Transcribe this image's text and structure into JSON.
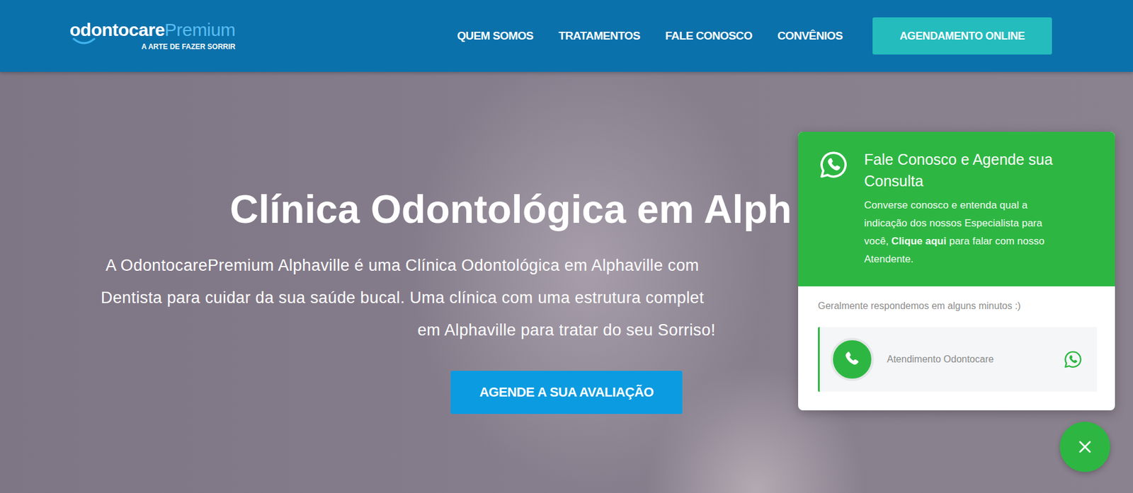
{
  "header": {
    "logo": {
      "brand": "odontocare",
      "suffix": "Premium",
      "tagline": "A ARTE DE FAZER SORRIR"
    },
    "nav": [
      {
        "label": "QUEM SOMOS"
      },
      {
        "label": "TRATAMENTOS"
      },
      {
        "label": "FALE CONOSCO"
      },
      {
        "label": "CONVÊNIOS"
      }
    ],
    "cta": "AGENDAMENTO ONLINE"
  },
  "hero": {
    "title": "Clínica Odontológica em Alph",
    "lines": [
      "A OdontocarePremium Alphaville é uma Clínica Odontológica em Alphaville com",
      "Dentista para cuidar da sua saúde bucal. Uma clínica com uma estrutura complet",
      "em Alphaville para tratar do seu Sorriso!"
    ],
    "button": "AGENDE A SUA AVALIAÇÃO"
  },
  "chat": {
    "open": true,
    "title": "Fale Conosco e Agende sua Consulta",
    "message": {
      "before": "Converse conosco e entenda qual a indicação dos nossos Especialista para você, ",
      "bold": "Clique aqui",
      "after": " para falar com nosso Atendente."
    },
    "note": "Geralmente respondemos em alguns minutos :)",
    "agent": "Atendimento Odontocare"
  }
}
